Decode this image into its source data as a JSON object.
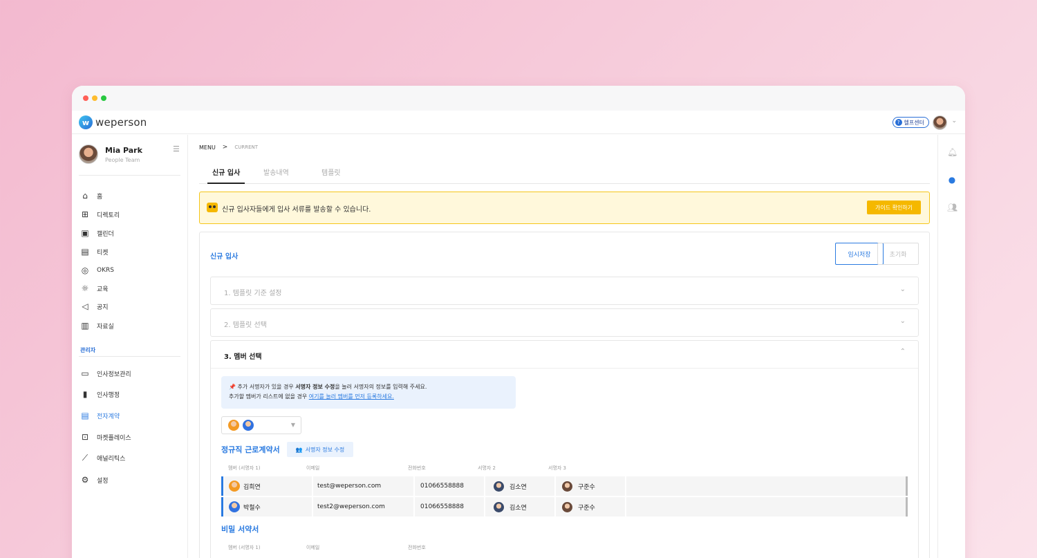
{
  "app": {
    "logo_mark": "w",
    "logo_text": "weperson",
    "help_label": "헬프센터"
  },
  "profile": {
    "name": "Mia Park",
    "team": "People Team"
  },
  "sidebar": {
    "items": [
      {
        "icon": "home-icon",
        "label": "홈"
      },
      {
        "icon": "directory-icon",
        "label": "디렉토리"
      },
      {
        "icon": "calendar-icon",
        "label": "캘린더"
      },
      {
        "icon": "ticket-icon",
        "label": "티켓"
      },
      {
        "icon": "target-icon",
        "label": "OKRS"
      },
      {
        "icon": "lightbulb-icon",
        "label": "교육"
      },
      {
        "icon": "megaphone-icon",
        "label": "공지"
      },
      {
        "icon": "archive-icon",
        "label": "자료실"
      }
    ],
    "admin_label": "관리자",
    "admin_items": [
      {
        "icon": "folder-person-icon",
        "label": "인사정보관리"
      },
      {
        "icon": "document-icon",
        "label": "인사행정"
      },
      {
        "icon": "contract-icon",
        "label": "전자계약",
        "active": true
      },
      {
        "icon": "gift-icon",
        "label": "마켓플레이스"
      },
      {
        "icon": "analytics-icon",
        "label": "애널리틱스"
      },
      {
        "icon": "gear-icon",
        "label": "설정"
      }
    ]
  },
  "breadcrumb": {
    "menu": "MENU",
    "separator": ">",
    "current": "CURRENT"
  },
  "tabs": [
    "신규 입사",
    "발송내역",
    "템플릿"
  ],
  "banner": {
    "text": "신규 입사자들에게 입사 서류를 발송할 수 있습니다.",
    "button": "가이드 확인하기"
  },
  "card": {
    "title": "신규 입사",
    "save_label": "임시저장",
    "reset_label": "초기화",
    "steps": [
      "1. 템플릿 기준 설정",
      "2. 템플릿 선택",
      "3. 멤버 선택"
    ]
  },
  "notice": {
    "pin": "📌",
    "line1_pre": "추가 서명자가 있을 경우 ",
    "line1_bold": "서명자 정보 수정",
    "line1_post": "을 눌러 서명자의 정보를 입력해 주세요.",
    "line2_pre": "추가할 멤버가 리스트에 없을 경우 ",
    "line2_link": "여기를 눌러 멤버를 먼저 등록하세요."
  },
  "contracts": [
    {
      "title": "정규직 근로계약서",
      "edit_label": "서명자 정보 수정",
      "columns": [
        "멤버 (서명자 1)",
        "이메일",
        "전화번호",
        "서명자 2",
        "서명자 3"
      ],
      "rows": [
        {
          "name": "김희연",
          "email": "test@weperson.com",
          "phone": "01066558888",
          "signer2": "김소연",
          "signer3": "구준수"
        },
        {
          "name": "박철수",
          "email": "test2@weperson.com",
          "phone": "01066558888",
          "signer2": "김소연",
          "signer3": "구준수"
        }
      ]
    },
    {
      "title": "비밀 서약서",
      "columns": [
        "멤버 (서명자 1)",
        "이메일",
        "전화번호"
      ]
    }
  ]
}
